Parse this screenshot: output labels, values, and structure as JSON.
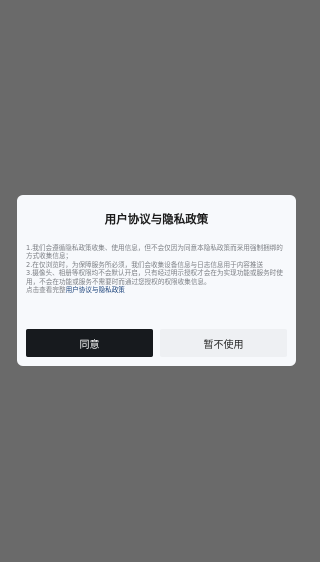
{
  "dialog": {
    "title": "用户协议与隐私政策",
    "paragraphs": [
      "1.我们会遵循隐私政策收集、使用信息，但不会仅因为同意本隐私政策而采用强制捆绑的方式收集信息；",
      "2.在仅浏览时，为保障服务所必须，我们会收集设备信息与日志信息用于内容推送",
      "3.摄像头、相册等权限均不会默认开启，只有经过明示授权才会在为实现功能或服务时使用，不会在功能或服务不需要时而通过您授权的权限收集信息。"
    ],
    "link_prefix": "点击查看完整",
    "link_label": "用户协议与隐私政策",
    "agree_label": "同意",
    "decline_label": "暂不使用"
  },
  "colors": {
    "overlay": "#6a6a6a",
    "dialog_bg": "#f7f9fc",
    "agree_bg": "#171a1e",
    "decline_bg": "#eef0f3",
    "link": "#173f78"
  }
}
